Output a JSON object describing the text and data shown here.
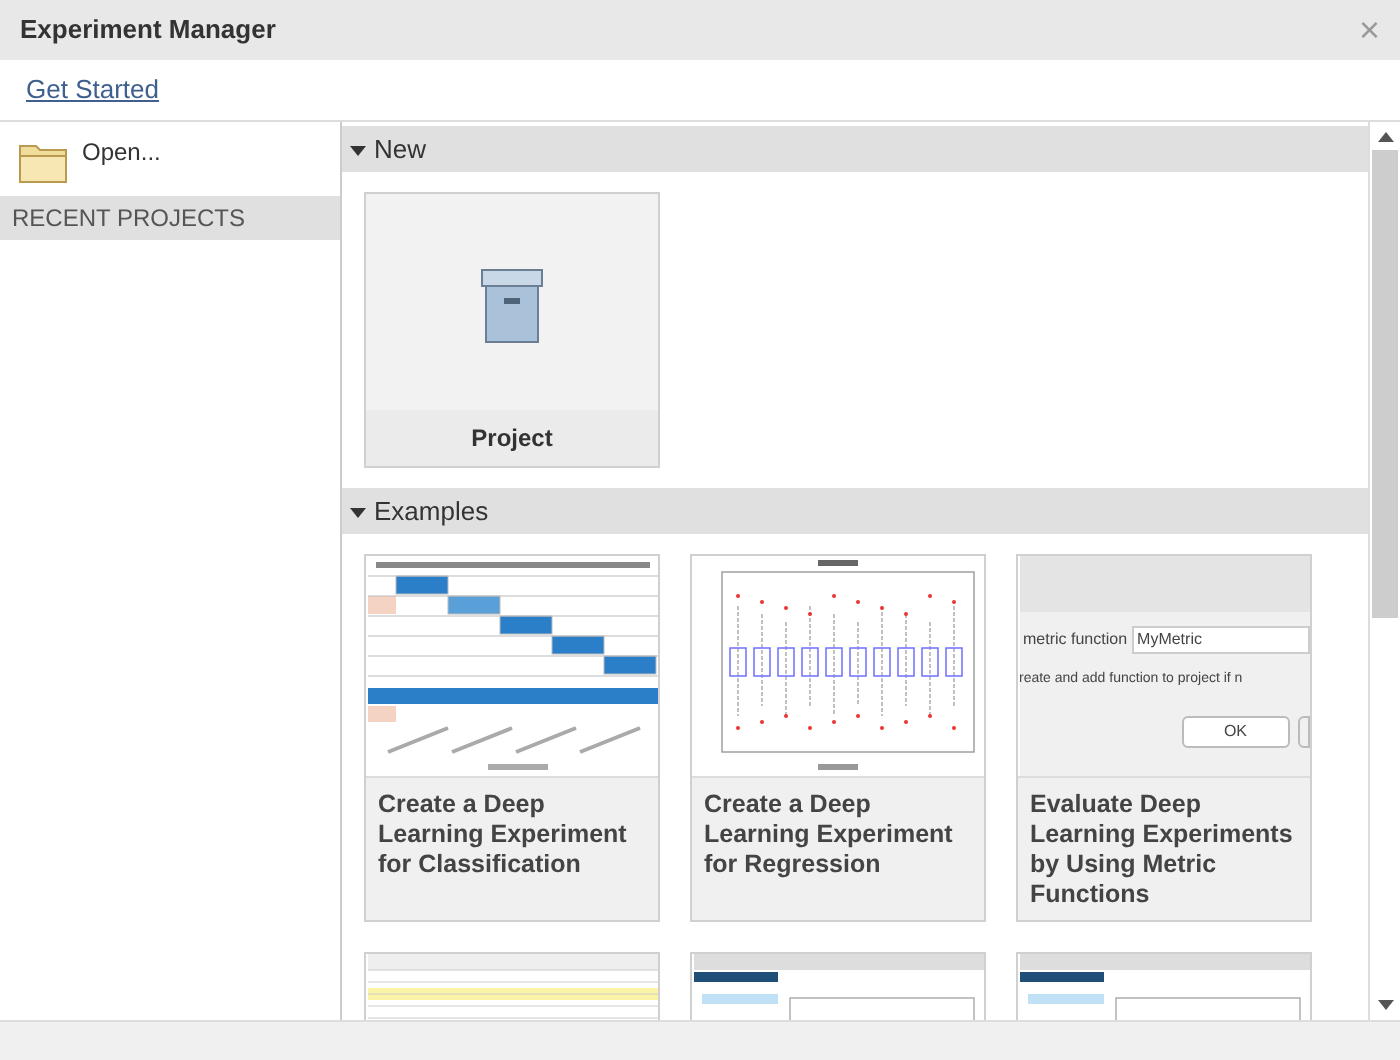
{
  "window": {
    "title": "Experiment Manager",
    "close": "×"
  },
  "link": "Get Started",
  "sidebar": {
    "open": "Open...",
    "section": "RECENT PROJECTS"
  },
  "sections": [
    {
      "title": "New",
      "expanded": true,
      "cards": [
        {
          "kind": "project",
          "title": "Project"
        }
      ]
    },
    {
      "title": "Examples",
      "expanded": true,
      "cards": [
        {
          "kind": "confusion",
          "title": "Create a Deep Learning Experiment for Classification"
        },
        {
          "kind": "boxplot",
          "title": "Create a Deep Learning Experiment for Regression"
        },
        {
          "kind": "dialog",
          "title": "Evaluate Deep Learning Experiments by Using Metric Functions",
          "label": "metric function",
          "value": "MyMetric",
          "note": "reate and add function to project if n",
          "button": "OK"
        },
        {
          "kind": "table"
        },
        {
          "kind": "app"
        },
        {
          "kind": "app"
        }
      ]
    }
  ]
}
